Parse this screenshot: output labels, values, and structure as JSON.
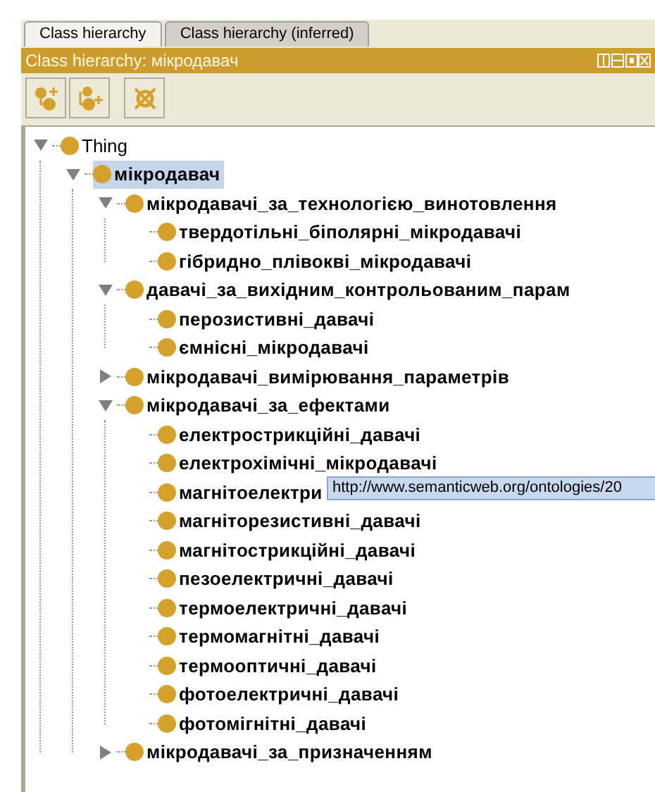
{
  "tabs": [
    {
      "label": "Class hierarchy",
      "selected": true
    },
    {
      "label": "Class hierarchy (inferred)",
      "selected": false
    }
  ],
  "panel": {
    "title": "Class hierarchy: мікродавач"
  },
  "toolbar": [
    {
      "kind": "add-subclass"
    },
    {
      "kind": "add-sibling"
    },
    {
      "kind": "delete"
    }
  ],
  "tree": [
    {
      "label": "Thing",
      "bold": false,
      "selected": false,
      "expanded": true,
      "children": [
        {
          "label": "мікродавач",
          "bold": true,
          "selected": true,
          "expanded": true,
          "children": [
            {
              "label": "мікродавачі_за_технологією_винотовлення",
              "bold": true,
              "selected": false,
              "expanded": true,
              "children": [
                {
                  "label": "твердотільні_біполярні_мікродавачі",
                  "bold": true,
                  "selected": false
                },
                {
                  "label": "гібридно_плівокві_мікродавачі",
                  "bold": true,
                  "selected": false
                }
              ]
            },
            {
              "label": "давачі_за_вихідним_контрольованим_парам",
              "bold": true,
              "selected": false,
              "expanded": true,
              "children": [
                {
                  "label": "перозистивні_давачі",
                  "bold": true,
                  "selected": false
                },
                {
                  "label": "ємнісні_мікродавачі",
                  "bold": true,
                  "selected": false
                }
              ]
            },
            {
              "label": "мікродавачі_вимірювання_параметрів",
              "bold": true,
              "selected": false,
              "expanded": false
            },
            {
              "label": "мікродавачі_за_ефектами",
              "bold": true,
              "selected": false,
              "expanded": true,
              "children": [
                {
                  "label": "електрострикційні_давачі",
                  "bold": true,
                  "selected": false
                },
                {
                  "label": "електрохімічні_мікродавачі",
                  "bold": true,
                  "selected": false
                },
                {
                  "label": "магнітоелектри",
                  "bold": true,
                  "selected": false
                },
                {
                  "label": "магніторезистивні_давачі",
                  "bold": true,
                  "selected": false
                },
                {
                  "label": "магнітострикційні_давачі",
                  "bold": true,
                  "selected": false
                },
                {
                  "label": "пезоелектричні_давачі",
                  "bold": true,
                  "selected": false
                },
                {
                  "label": "термоелектричні_давачі",
                  "bold": true,
                  "selected": false
                },
                {
                  "label": "термомагнітні_давачі",
                  "bold": true,
                  "selected": false
                },
                {
                  "label": "термооптичні_давачі",
                  "bold": true,
                  "selected": false
                },
                {
                  "label": "фотоелектричні_давачі",
                  "bold": true,
                  "selected": false
                },
                {
                  "label": "фотомігнітні_давачі",
                  "bold": true,
                  "selected": false
                }
              ]
            },
            {
              "label": "мікродавачі_за_призначенням",
              "bold": true,
              "selected": false,
              "expanded": false
            }
          ]
        }
      ]
    }
  ],
  "tooltip": "http://www.semanticweb.org/ontologies/20"
}
